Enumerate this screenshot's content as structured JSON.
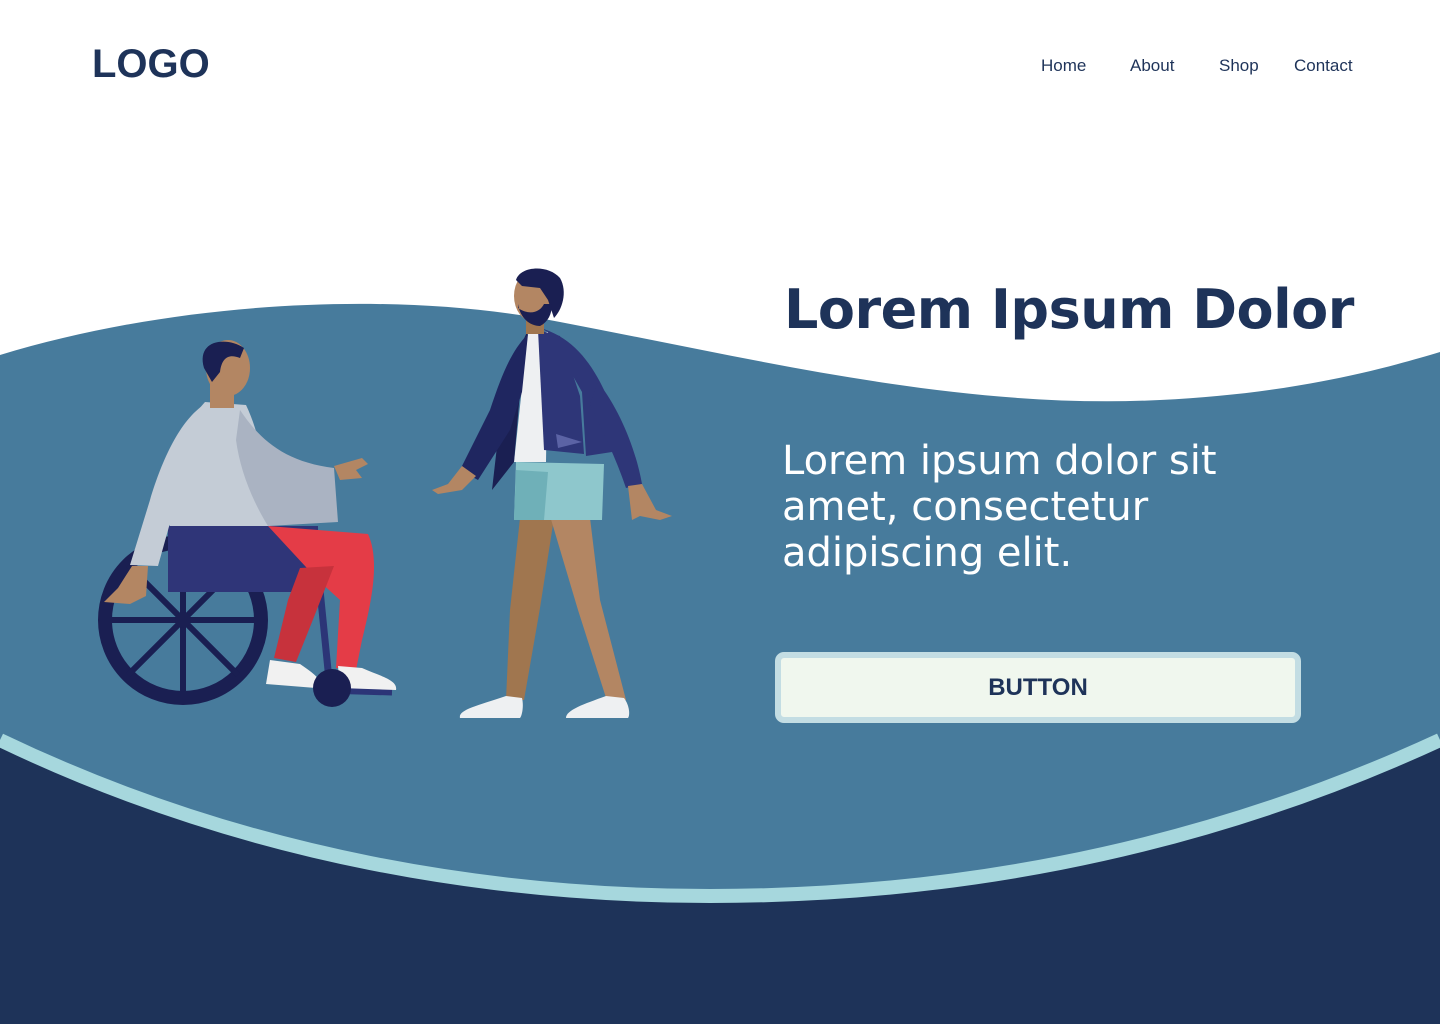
{
  "header": {
    "logo": "LOGO",
    "nav": [
      {
        "label": "Home"
      },
      {
        "label": "About"
      },
      {
        "label": "Shop"
      },
      {
        "label": "Contact"
      }
    ]
  },
  "hero": {
    "title": "Lorem Ipsum Dolor",
    "text": "Lorem ipsum dolor sit amet, consectetur adipiscing elit.",
    "button_label": "BUTTON"
  },
  "colors": {
    "navy": "#1e3359",
    "wave_blue": "#477b9c",
    "wave_stroke": "#a6d7dd",
    "button_bg": "#f0f7ee",
    "button_border": "#c3dde3"
  },
  "illustration": {
    "figures": [
      "person-in-wheelchair",
      "walking-person"
    ]
  }
}
